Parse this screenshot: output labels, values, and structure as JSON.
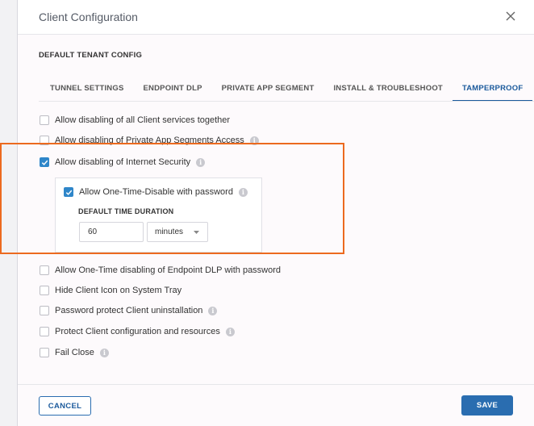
{
  "dialog": {
    "title": "Client Configuration",
    "close_icon": "close-icon"
  },
  "section_title": "DEFAULT TENANT CONFIG",
  "tabs": [
    {
      "label": "TUNNEL SETTINGS",
      "active": false
    },
    {
      "label": "ENDPOINT DLP",
      "active": false
    },
    {
      "label": "PRIVATE APP SEGMENT",
      "active": false
    },
    {
      "label": "INSTALL & TROUBLESHOOT",
      "active": false
    },
    {
      "label": "TAMPERPROOF",
      "active": true
    }
  ],
  "options": [
    {
      "label": "Allow disabling of all Client services together",
      "checked": false,
      "info": false
    },
    {
      "label": "Allow disabling of Private App Segments Access",
      "checked": false,
      "info": true
    },
    {
      "label": "Allow disabling of Internet Security",
      "checked": true,
      "info": true
    },
    {
      "label": "Allow One-Time disabling of Endpoint DLP with password",
      "checked": false,
      "info": false
    },
    {
      "label": "Hide Client Icon on System Tray",
      "checked": false,
      "info": false
    },
    {
      "label": "Password protect Client uninstallation",
      "checked": false,
      "info": true
    },
    {
      "label": "Protect Client configuration and resources",
      "checked": false,
      "info": true
    },
    {
      "label": "Fail Close",
      "checked": false,
      "info": true
    }
  ],
  "one_time_disable": {
    "label": "Allow One-Time-Disable with password",
    "checked": true,
    "duration_label": "DEFAULT TIME DURATION",
    "duration_value": "60",
    "unit_selected": "minutes"
  },
  "footer": {
    "cancel_label": "CANCEL",
    "save_label": "SAVE"
  },
  "colors": {
    "accent": "#2a6db0",
    "highlight": "#ec6a1f",
    "checkbox_checked": "#2f86c9"
  }
}
